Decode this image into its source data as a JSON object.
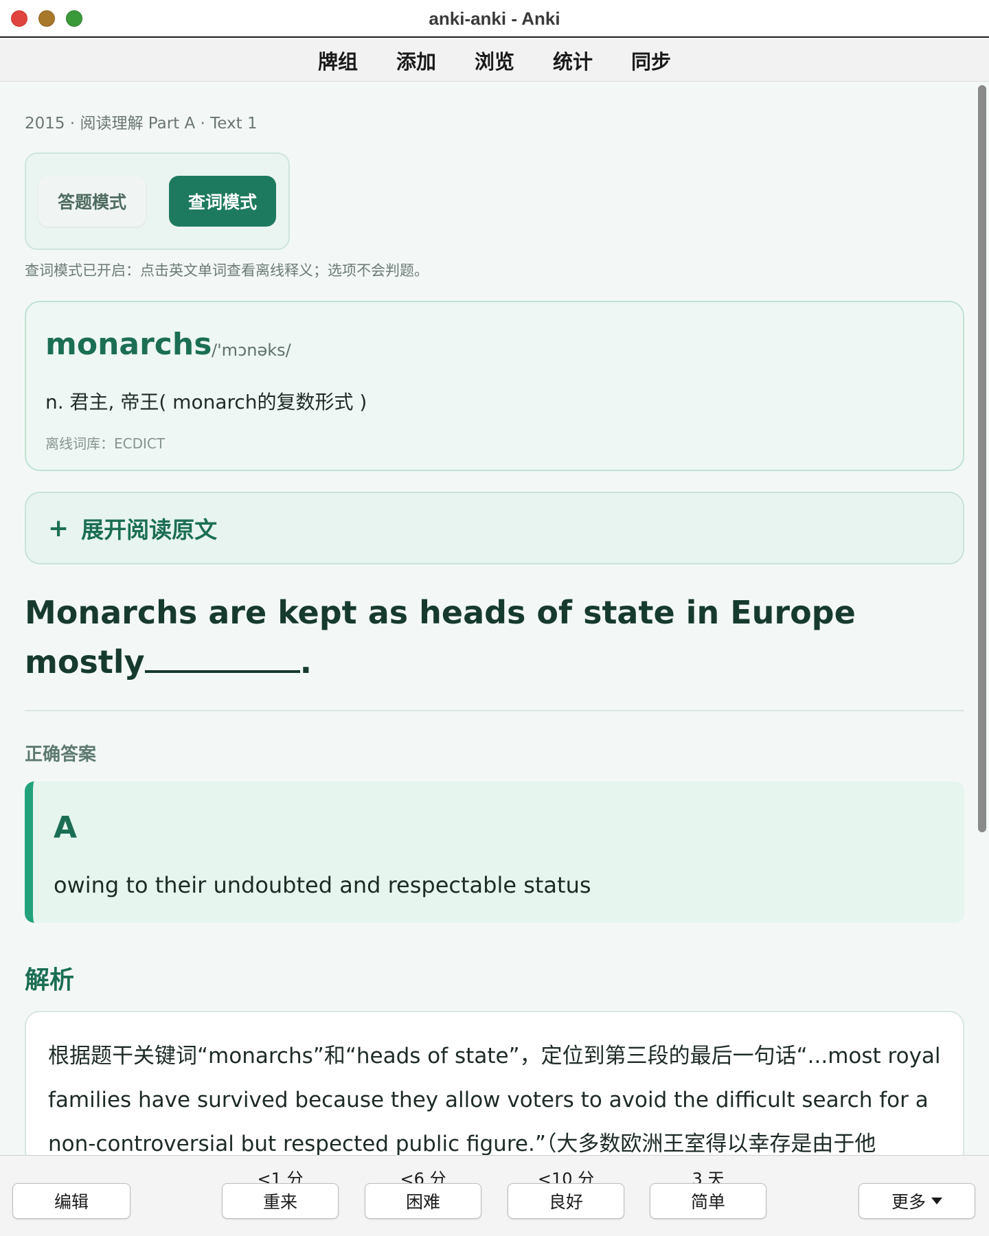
{
  "window": {
    "title": "anki-anki - Anki"
  },
  "toolbar": {
    "items": [
      "牌组",
      "添加",
      "浏览",
      "统计",
      "同步"
    ]
  },
  "card": {
    "breadcrumb": "2015 · 阅读理解 Part A · Text 1",
    "modes": {
      "answer": "答题模式",
      "lookup": "查词模式",
      "active": "lookup"
    },
    "hint": "查词模式已开启：点击英文单词查看离线释义；选项不会判题。",
    "dictionary": {
      "word": "monarchs",
      "phonetic": "/'mɔnəks/",
      "definition": "n. 君主, 帝王( monarch的复数形式 )",
      "source": "离线词库：ECDICT"
    },
    "expand_label": "展开阅读原文",
    "question_line1": "Monarchs are kept as heads of state in Europe",
    "question_line2_prefix": "mostly",
    "question_line2_suffix": ".",
    "correct_label": "正确答案",
    "answer_letter": "A",
    "answer_text": "owing to their undoubted and respectable status",
    "analysis_title": "解析",
    "analysis_text": "根据题干关键词“monarchs”和“heads of state”，定位到第三段的最后一句话“...most royal families have survived because they allow voters to avoid the difficult search for a non-controversial but respected public figure.”（大多数欧洲王室得以幸存是由于他"
  },
  "bottom": {
    "edit": "编辑",
    "again": {
      "label": "重来",
      "interval": "<1 分"
    },
    "hard": {
      "label": "困难",
      "interval": "<6 分"
    },
    "good": {
      "label": "良好",
      "interval": "<10 分"
    },
    "easy": {
      "label": "简单",
      "interval": "3 天"
    },
    "more": "更多"
  },
  "colors": {
    "accent": "#1e7a5e",
    "answer_bar": "#22a27b",
    "heading": "#173a2f"
  }
}
